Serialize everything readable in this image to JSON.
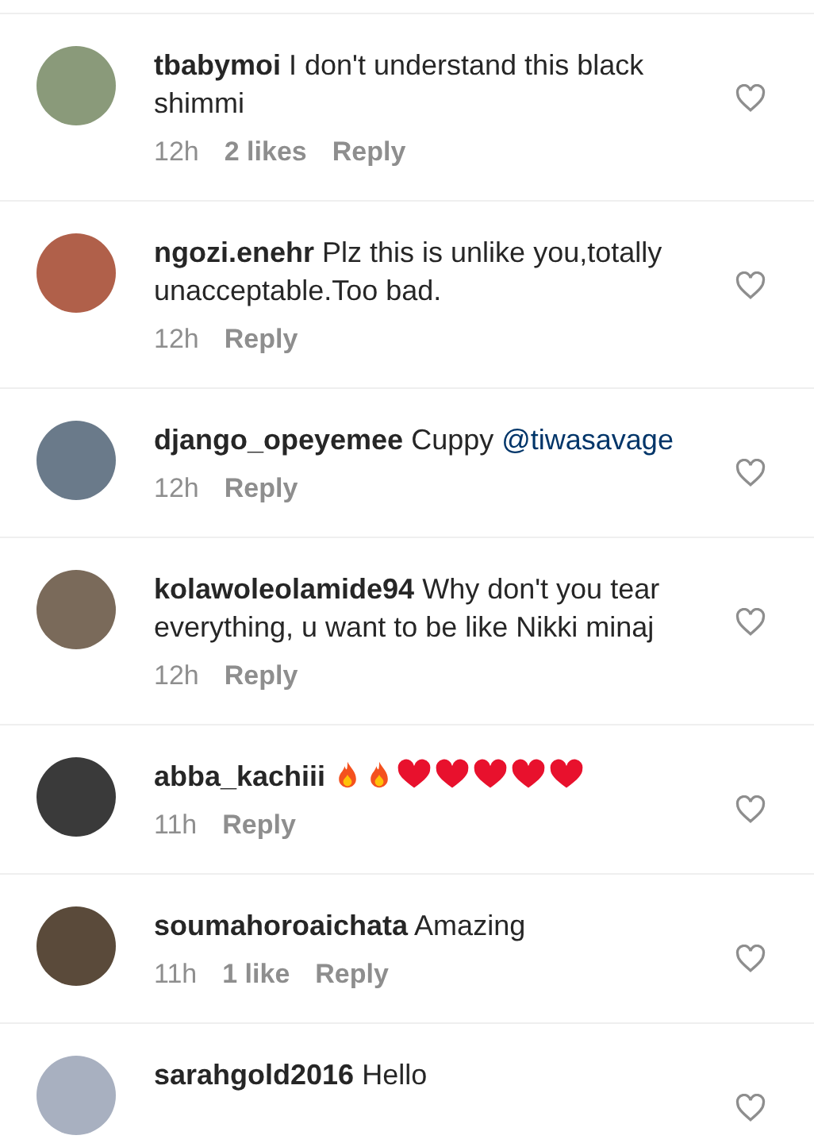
{
  "comments": [
    {
      "user": "tbabymoi",
      "text": "I don't understand this black shimmi",
      "time": "12h",
      "likes": "2 likes",
      "reply": "Reply",
      "liked": false
    },
    {
      "user": "ngozi.enehr",
      "text": "Plz this is unlike you,totally unacceptable.Too bad.",
      "time": "12h",
      "reply": "Reply",
      "liked": false
    },
    {
      "user": "django_opeyemee",
      "text": "Cuppy",
      "mention": "@tiwasavage",
      "time": "12h",
      "reply": "Reply",
      "liked": false
    },
    {
      "user": "kolawoleolamide94",
      "text": "Why don't you tear everything, u want to be like Nikki minaj",
      "time": "12h",
      "reply": "Reply",
      "liked": false
    },
    {
      "user": "abba_kachiii",
      "emojis": [
        {
          "kind": "fire"
        },
        {
          "kind": "fire"
        },
        {
          "kind": "heart"
        },
        {
          "kind": "heart"
        },
        {
          "kind": "heart"
        },
        {
          "kind": "heart"
        },
        {
          "kind": "heart"
        }
      ],
      "time": "11h",
      "reply": "Reply",
      "liked": false
    },
    {
      "user": "soumahoroaichata",
      "text": "Amazing",
      "time": "11h",
      "likes": "1 like",
      "reply": "Reply",
      "liked": false
    },
    {
      "user": "sarahgold2016",
      "text": "Hello",
      "liked": false
    }
  ]
}
